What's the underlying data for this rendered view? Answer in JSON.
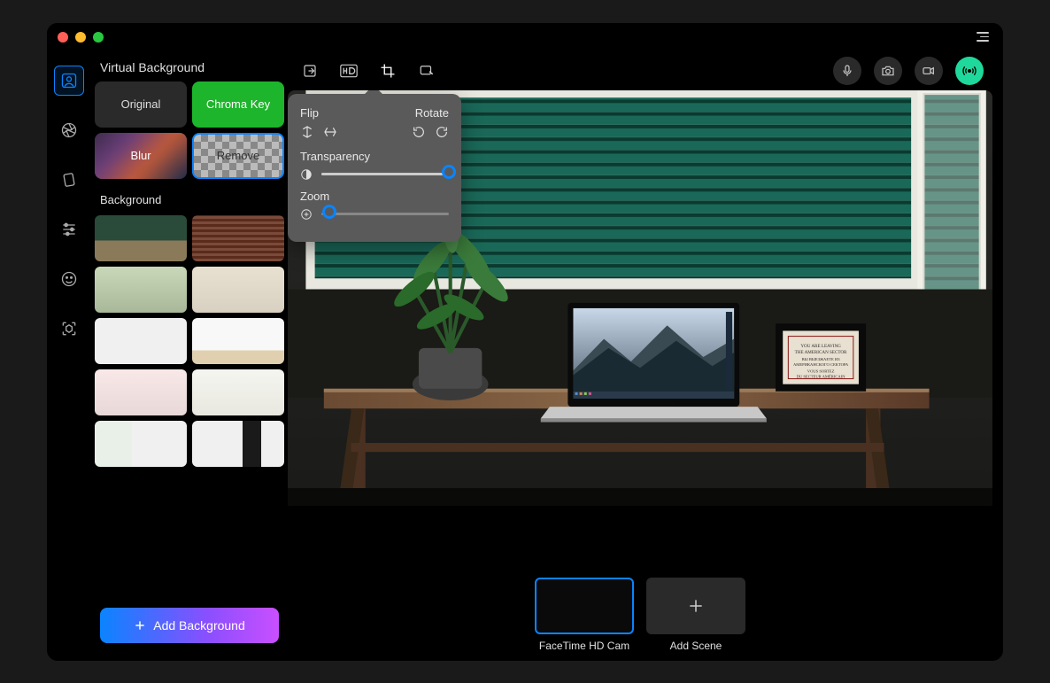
{
  "panel": {
    "title": "Virtual Background",
    "modes": {
      "original": "Original",
      "chroma": "Chroma Key",
      "blur": "Blur",
      "remove": "Remove"
    },
    "section_label": "Background",
    "add_button": "Add Background"
  },
  "popover": {
    "flip_label": "Flip",
    "rotate_label": "Rotate",
    "transparency_label": "Transparency",
    "zoom_label": "Zoom",
    "transparency_value": 100,
    "zoom_value": 0
  },
  "scenes": {
    "current": "FaceTime HD Cam",
    "add": "Add Scene"
  },
  "icons": {
    "nav": [
      "user-square",
      "aperture",
      "card-flip",
      "sliders",
      "face",
      "cube"
    ],
    "toolbar": [
      "import-icon",
      "hd-icon",
      "crop-icon",
      "marker-icon"
    ],
    "right_toolbar": [
      "mic-icon",
      "camera-icon",
      "video-icon",
      "broadcast-icon"
    ]
  },
  "colors": {
    "accent": "#0a84ff",
    "live": "#1ed99b",
    "chroma": "#1db52b"
  }
}
